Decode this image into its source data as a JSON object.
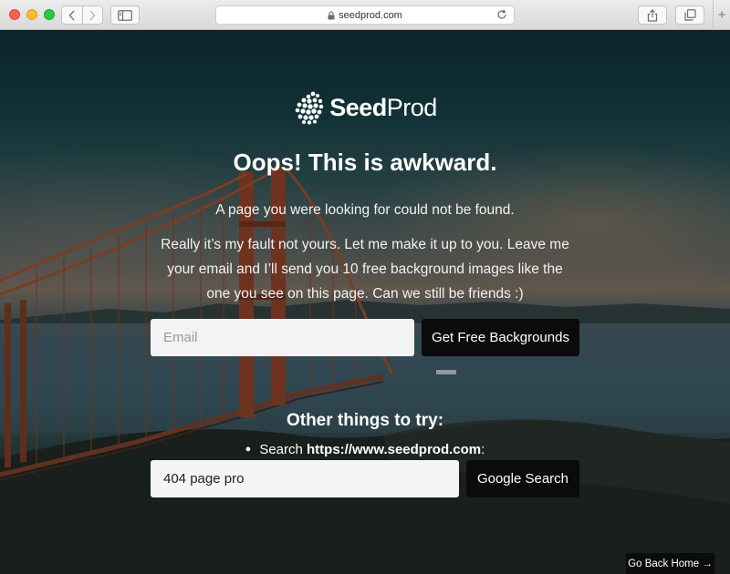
{
  "browser": {
    "url": "seedprod.com"
  },
  "brand": {
    "name_bold": "Seed",
    "name_regular": "Prod"
  },
  "content": {
    "title": "Oops! This is awkward.",
    "lead": "A page you were looking for could not be found.",
    "body": "Really it’s my fault not yours. Let me make it up to you. Leave me your email and I’ll send you 10 free background images like the one you see on this page. Can we still be friends :)"
  },
  "signup": {
    "email_placeholder": "Email",
    "submit_label": "Get Free Backgrounds"
  },
  "other": {
    "heading": "Other things to try:",
    "search_prefix": "Search ",
    "search_site": "https://www.seedprod.com",
    "search_suffix": ":",
    "search_value": "404 page pro",
    "search_button": "Google Search"
  },
  "footer": {
    "go_home": "Go Back Home →"
  },
  "colors": {
    "button_bg": "#0b0b0b",
    "input_bg": "#f3f3f3",
    "text": "#ffffff"
  }
}
